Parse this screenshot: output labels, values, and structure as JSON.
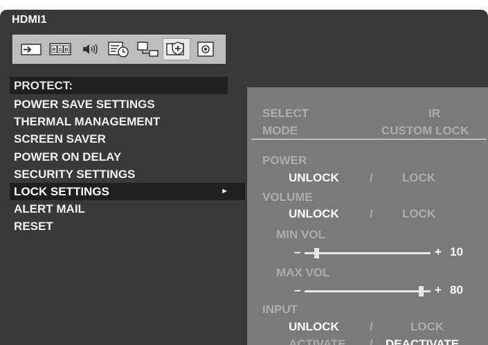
{
  "window": {
    "title": "HDMI1"
  },
  "iconbar": {
    "icons": [
      {
        "name": "input-icon"
      },
      {
        "name": "rgb-icon",
        "text": "RGB"
      },
      {
        "name": "audio-icon"
      },
      {
        "name": "schedule-icon"
      },
      {
        "name": "network-icon"
      },
      {
        "name": "protect-icon",
        "active": true
      },
      {
        "name": "system-icon"
      }
    ]
  },
  "left_menu": {
    "heading": "PROTECT:",
    "items": [
      "POWER SAVE SETTINGS",
      "THERMAL MANAGEMENT",
      "SCREEN SAVER",
      "POWER ON DELAY",
      "SECURITY SETTINGS",
      "LOCK SETTINGS",
      "ALERT MAIL",
      "RESET"
    ],
    "selected_arrow": "►"
  },
  "right_panel": {
    "select_label": "SELECT",
    "select_value": "IR",
    "mode_label": "MODE",
    "mode_value": "CUSTOM LOCK",
    "power_label": "POWER",
    "volume_label": "VOLUME",
    "input_label": "INPUT",
    "unlock": "UNLOCK",
    "slash": "/",
    "lock": "LOCK",
    "min_vol_label": "MIN VOL",
    "min_vol_value": "10",
    "max_vol_label": "MAX VOL",
    "max_vol_value": "80",
    "minus": "–",
    "plus": "+",
    "activate": "ACTIVATE",
    "deactivate": "DEACTIVATE"
  }
}
